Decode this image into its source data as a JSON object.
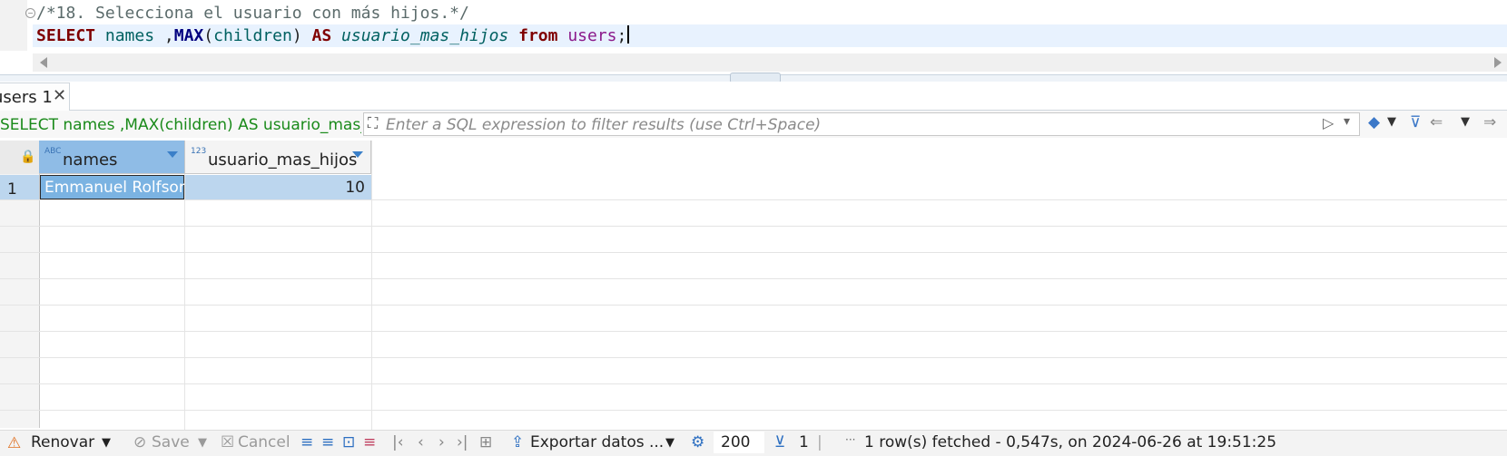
{
  "editor": {
    "comment": "/*18. Selecciona el usuario con más hijos.*/",
    "sql": {
      "select": "SELECT",
      "col": "names",
      "comma": " ,",
      "max": "MAX",
      "paren_open": "(",
      "arg": "children",
      "paren_close": ")",
      "as": "AS",
      "alias": "usuario_mas_hijos",
      "from": "from",
      "table": "users",
      "semi": ";"
    }
  },
  "results_tab": {
    "label": "users 1",
    "close": "✕"
  },
  "filter": {
    "sql_preview": "SELECT names ,MAX(children) AS usuario_mas_hijos from users",
    "placeholder": "Enter a SQL expression to filter results (use Ctrl+Space)"
  },
  "grid": {
    "columns": [
      {
        "type": "ABC",
        "name": "names"
      },
      {
        "type": "123",
        "name": "usuario_mas_hijos"
      }
    ],
    "rows": [
      {
        "num": "1",
        "names": "Emmanuel Rolfson",
        "usuario_mas_hijos": "10"
      }
    ]
  },
  "bottom": {
    "refresh": "Renovar",
    "save": "Save",
    "cancel": "Cancel",
    "export": "Exportar datos ...",
    "fetch_size": "200",
    "row_count": "1",
    "dots": "···",
    "status": "1 row(s) fetched - 0,547s, on 2024-06-26 at 19:51:25"
  }
}
